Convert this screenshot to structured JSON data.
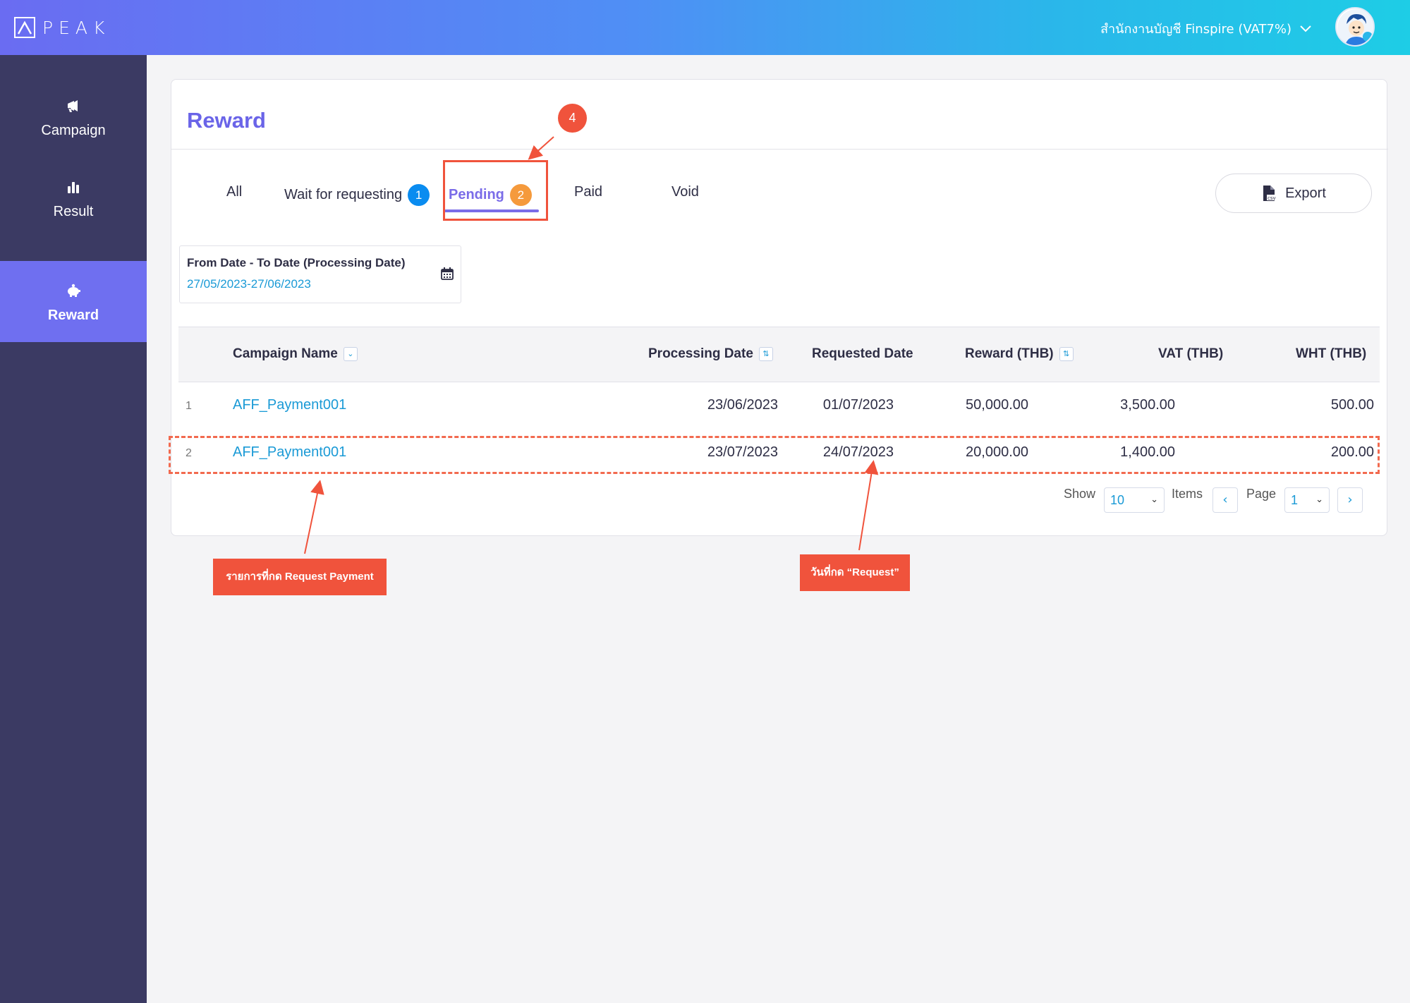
{
  "header": {
    "logo_text": "PEAK",
    "org_name": "สำนักงานบัญชี Finspire (VAT7%)"
  },
  "sidebar": {
    "items": [
      {
        "label": "Campaign",
        "icon": "megaphone-icon"
      },
      {
        "label": "Result",
        "icon": "bar-chart-icon"
      },
      {
        "label": "Reward",
        "icon": "piggy-bank-icon",
        "active": true
      }
    ]
  },
  "page": {
    "title": "Reward",
    "tabs": [
      {
        "label": "All"
      },
      {
        "label": "Wait for requesting",
        "badge": "1",
        "badge_color": "#0a8cf0"
      },
      {
        "label": "Pending",
        "badge": "2",
        "badge_color": "#f59a3c",
        "active": true
      },
      {
        "label": "Paid"
      },
      {
        "label": "Void"
      }
    ],
    "export_label": "Export",
    "date_filter": {
      "label": "From Date - To Date (Processing Date)",
      "value": "27/05/2023-27/06/2023"
    }
  },
  "table": {
    "columns": [
      "Campaign Name",
      "Processing Date",
      "Requested Date",
      "Reward (THB)",
      "VAT (THB)",
      "WHT (THB)"
    ],
    "rows": [
      {
        "no": "1",
        "campaign": "AFF_Payment001",
        "processing": "23/06/2023",
        "requested": "01/07/2023",
        "reward": "50,000.00",
        "vat": "3,500.00",
        "wht": "500.00"
      },
      {
        "no": "2",
        "campaign": "AFF_Payment001",
        "processing": "23/07/2023",
        "requested": "24/07/2023",
        "reward": "20,000.00",
        "vat": "1,400.00",
        "wht": "200.00"
      }
    ]
  },
  "pagination": {
    "show_label": "Show",
    "page_size": "10",
    "items_label": "Items",
    "page_label": "Page",
    "page": "1",
    "prev": "‹",
    "next": "›"
  },
  "annotations": {
    "step_number": "4",
    "label_left": "รายการที่กด Request Payment",
    "label_right": "วันที่กด “Request”",
    "color": "#f0533c"
  }
}
